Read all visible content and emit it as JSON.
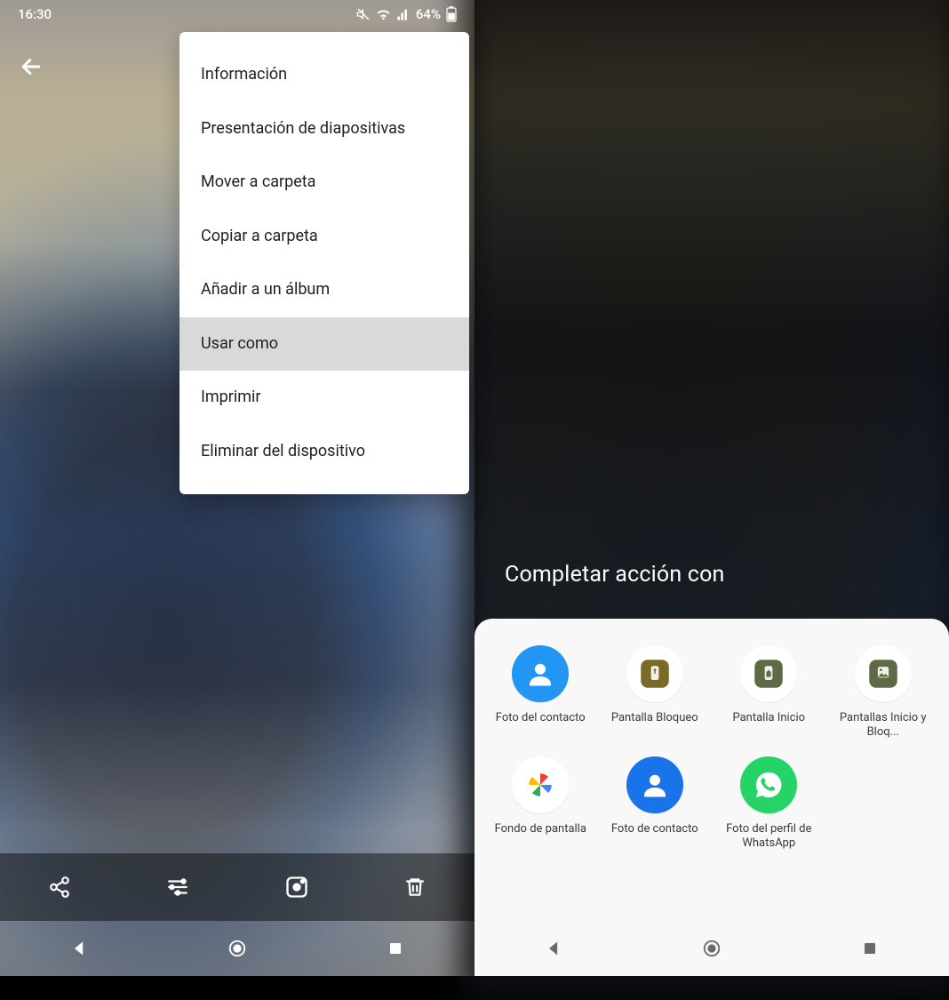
{
  "status": {
    "time": "16:30",
    "battery_pct": "64%"
  },
  "menu": {
    "items": [
      {
        "label": "Información",
        "hl": false
      },
      {
        "label": "Presentación de diapositivas",
        "hl": false
      },
      {
        "label": "Mover a carpeta",
        "hl": false
      },
      {
        "label": "Copiar a carpeta",
        "hl": false
      },
      {
        "label": "Añadir a un álbum",
        "hl": false
      },
      {
        "label": "Usar como",
        "hl": true
      },
      {
        "label": "Imprimir",
        "hl": false
      },
      {
        "label": "Eliminar del dispositivo",
        "hl": false
      }
    ]
  },
  "chooser": {
    "title": "Completar acción con",
    "apps": [
      {
        "id": "contact-photo",
        "label": "Foto del contacto"
      },
      {
        "id": "lock-screen",
        "label": "Pantalla Bloqueo"
      },
      {
        "id": "home-screen",
        "label": "Pantalla Inicio"
      },
      {
        "id": "both-screens",
        "label": "Pantallas Inicio y Bloq..."
      },
      {
        "id": "wallpaper",
        "label": "Fondo de pantalla"
      },
      {
        "id": "contact-photo-2",
        "label": "Foto de contacto"
      },
      {
        "id": "whatsapp-photo",
        "label": "Foto del perfil de WhatsApp"
      }
    ]
  }
}
